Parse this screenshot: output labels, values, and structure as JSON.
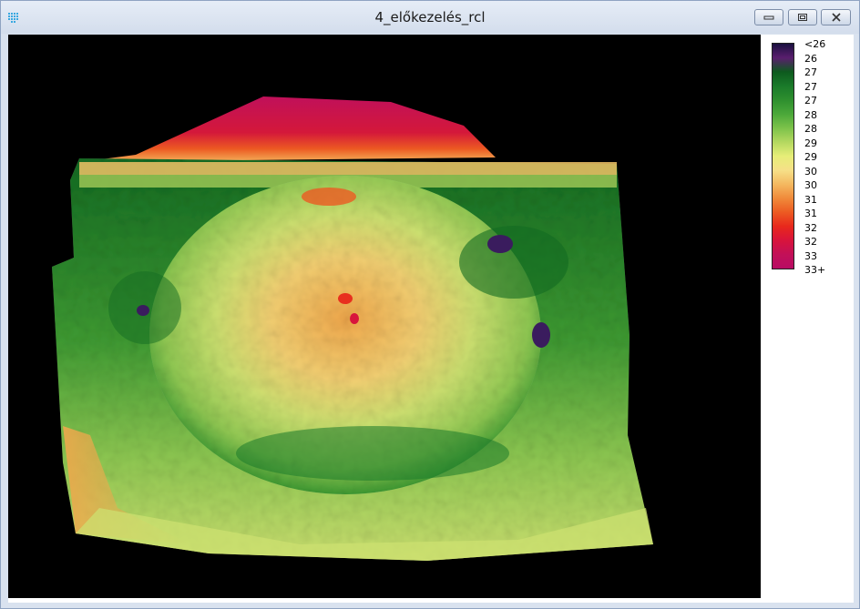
{
  "window": {
    "title": "4_előkezelés_rcl"
  },
  "legend": {
    "labels": [
      "<26",
      "26",
      "27",
      "27",
      "27",
      "28",
      "28",
      "29",
      "29",
      "30",
      "30",
      "31",
      "31",
      "32",
      "32",
      "33",
      "33+"
    ],
    "colors": [
      "#1a1040",
      "#5a1e6e",
      "#0d5a1e",
      "#1a7a2a",
      "#2e8f2e",
      "#4ba83a",
      "#7cc24a",
      "#b4d860",
      "#e6ee78",
      "#f6e088",
      "#f4b860",
      "#f08a3a",
      "#ec5a22",
      "#e8281c",
      "#d8143c",
      "#c21058",
      "#b80c64"
    ]
  },
  "map": {
    "description_colors": {
      "background": "#000000",
      "dark_green": "#136b22",
      "green": "#3e9a32",
      "light_green": "#8fc852",
      "yellow_green": "#cce070",
      "yellow": "#f2e480",
      "orange": "#f0a84c",
      "red": "#e8301e",
      "magenta": "#c0105a",
      "purple": "#3a1c5e"
    }
  }
}
